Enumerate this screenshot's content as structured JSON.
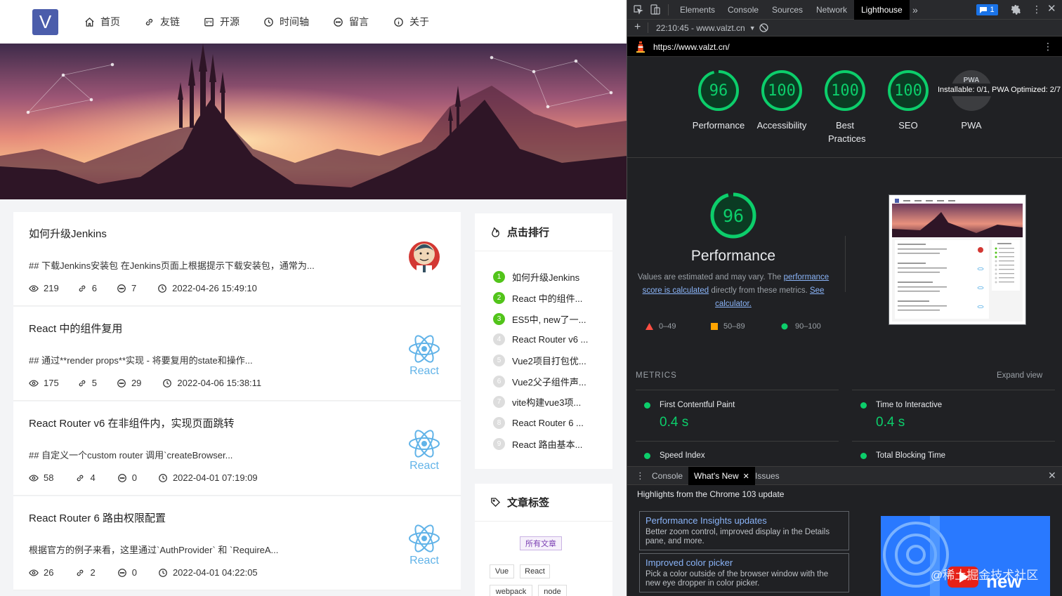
{
  "site": {
    "logo_letter": "V",
    "nav": [
      {
        "label": "首页",
        "icon": "home-icon"
      },
      {
        "label": "友链",
        "icon": "link-icon"
      },
      {
        "label": "开源",
        "icon": "code-icon"
      },
      {
        "label": "时间轴",
        "icon": "clock-icon"
      },
      {
        "label": "留言",
        "icon": "message-icon"
      },
      {
        "label": "关于",
        "icon": "info-icon"
      }
    ],
    "articles": [
      {
        "title": "如何升级Jenkins",
        "summary": "## 下载Jenkins安装包 在Jenkins页面上根据提示下载安装包，通常为...",
        "views": "219",
        "links": "6",
        "comments": "7",
        "date": "2022-04-26 15:49:10",
        "thumb": "jenkins"
      },
      {
        "title": "React 中的组件复用",
        "summary": "## 通过**render props**实现 - 将要复用的state和操作...",
        "views": "175",
        "links": "5",
        "comments": "29",
        "date": "2022-04-06 15:38:11",
        "thumb": "react"
      },
      {
        "title": "React Router v6 在非组件内，实现页面跳转",
        "summary": "## 自定义一个custom router 调用`createBrowser...",
        "views": "58",
        "links": "4",
        "comments": "0",
        "date": "2022-04-01 07:19:09",
        "thumb": "react"
      },
      {
        "title": "React Router 6 路由权限配置",
        "summary": "根据官方的例子来看，这里通过`AuthProvider` 和 `RequireA...",
        "views": "26",
        "links": "2",
        "comments": "0",
        "date": "2022-04-01 04:22:05",
        "thumb": "react"
      }
    ],
    "react_label": "React",
    "ranking": {
      "title": "点击排行",
      "items": [
        "如何升级Jenkins",
        "React 中的组件...",
        "ES5中, new了一...",
        "React Router v6 ...",
        "Vue2项目打包优...",
        "Vue2父子组件声...",
        "vite构建vue3项...",
        "React Router 6 ...",
        "React 路由基本..."
      ],
      "numbers": [
        "1",
        "2",
        "3",
        "4",
        "5",
        "6",
        "7",
        "8",
        "9"
      ]
    },
    "tags": {
      "title": "文章标签",
      "all": "所有文章",
      "items": [
        "Vue",
        "React",
        "webpack",
        "node"
      ]
    }
  },
  "devtools": {
    "tabs": [
      "Elements",
      "Console",
      "Sources",
      "Network",
      "Lighthouse"
    ],
    "more": "»",
    "issues_count": "1",
    "report_select": "22:10:45 - www.valzt.cn",
    "url": "https://www.valzt.cn/",
    "scores": [
      {
        "value": "96",
        "label": "Performance"
      },
      {
        "value": "100",
        "label": "Accessibility"
      },
      {
        "value": "100",
        "label": "Best Practices"
      },
      {
        "value": "100",
        "label": "SEO"
      }
    ],
    "pwa": {
      "label": "PWA",
      "badge": "PWA",
      "tooltip": "Installable: 0/1, PWA Optimized: 2/7"
    },
    "perf": {
      "score": "96",
      "title": "Performance",
      "desc_pre": "Values are estimated and may vary. The ",
      "desc_link1": "performance score is calculated",
      "desc_mid": " directly from these metrics. ",
      "desc_link2": "See calculator.",
      "legend": [
        "0–49",
        "50–89",
        "90–100"
      ]
    },
    "metrics": {
      "heading": "METRICS",
      "expand": "Expand view",
      "items": [
        {
          "name": "First Contentful Paint",
          "value": "0.4 s"
        },
        {
          "name": "Time to Interactive",
          "value": "0.4 s"
        },
        {
          "name": "Speed Index",
          "value": ""
        },
        {
          "name": "Total Blocking Time",
          "value": ""
        }
      ]
    },
    "drawer": {
      "tabs": [
        "Console",
        "What's New",
        "Issues"
      ],
      "highlight": "Highlights from the Chrome 103 update",
      "cards": [
        {
          "title": "Performance Insights updates",
          "desc": "Better zoom control, improved display in the Details pane, and more."
        },
        {
          "title": "Improved color picker",
          "desc": "Pick a color outside of the browser window with the new eye dropper in color picker."
        }
      ],
      "video_text": "new",
      "watermark": "@稀土掘金技术社区"
    },
    "colors": {
      "pass": "#0cce6b",
      "average": "#ffa400",
      "fail": "#ff4e42"
    }
  }
}
